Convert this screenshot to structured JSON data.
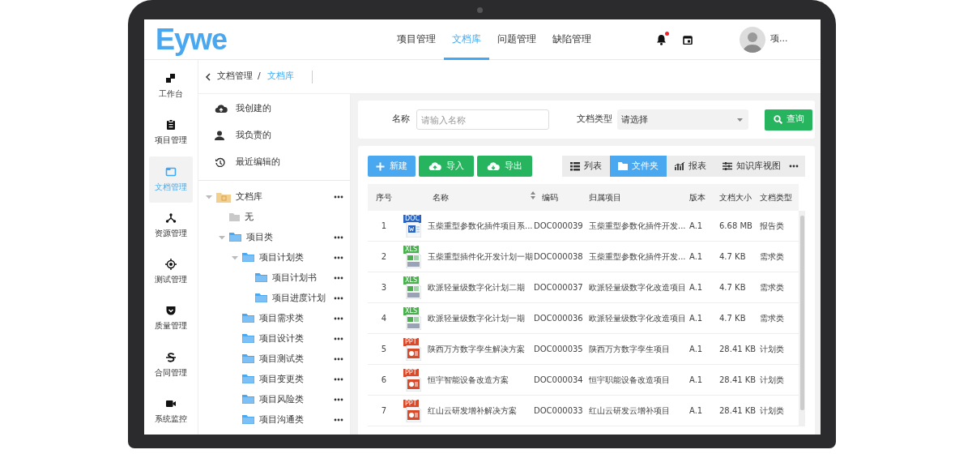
{
  "logo": "Eywe",
  "nav": [
    {
      "label": "项目管理",
      "selected": false
    },
    {
      "label": "文档库",
      "selected": true
    },
    {
      "label": "问题管理",
      "selected": false
    },
    {
      "label": "缺陷管理",
      "selected": false
    }
  ],
  "header": {
    "has_notification": true,
    "user": "项..."
  },
  "rail": [
    {
      "label": "工作台",
      "selected": false
    },
    {
      "label": "项目管理",
      "selected": false
    },
    {
      "label": "文档管理",
      "selected": true
    },
    {
      "label": "资源管理",
      "selected": false
    },
    {
      "label": "测试管理",
      "selected": false
    },
    {
      "label": "质量管理",
      "selected": false
    },
    {
      "label": "合同管理",
      "selected": false
    },
    {
      "label": "系统监控",
      "selected": false
    }
  ],
  "breadcrumb": [
    "文档管理",
    "文档库"
  ],
  "breadcrumb_separator": "/",
  "quick_links": [
    "我创建的",
    "我负责的",
    "最近编辑的"
  ],
  "tree": [
    {
      "label": "文档库",
      "kind": "root",
      "expanded": true,
      "children": [
        {
          "label": "无",
          "kind": "empty"
        },
        {
          "label": "项目类",
          "kind": "folder",
          "expanded": true,
          "children": [
            {
              "label": "项目计划类",
              "kind": "folder",
              "expanded": true,
              "children": [
                {
                  "label": "项目计划书",
                  "kind": "folder"
                },
                {
                  "label": "项目进度计划",
                  "kind": "folder"
                }
              ]
            },
            {
              "label": "项目需求类",
              "kind": "folder"
            },
            {
              "label": "项目设计类",
              "kind": "folder"
            },
            {
              "label": "项目测试类",
              "kind": "folder"
            },
            {
              "label": "项目变更类",
              "kind": "folder"
            },
            {
              "label": "项目风险类",
              "kind": "folder"
            },
            {
              "label": "项目沟通类",
              "kind": "folder"
            }
          ]
        }
      ]
    }
  ],
  "filters": {
    "name_label": "名称",
    "name_placeholder": "请输入名称",
    "type_label": "文档类型",
    "type_value": "请选择",
    "search_button": "查询"
  },
  "actions": [
    {
      "label": "新建",
      "kind": "new"
    },
    {
      "label": "导入",
      "kind": "import"
    },
    {
      "label": "导出",
      "kind": "export"
    }
  ],
  "views": [
    {
      "label": "列表",
      "selected": false
    },
    {
      "label": "文件夹",
      "selected": true
    },
    {
      "label": "报表",
      "selected": false
    },
    {
      "label": "知识库视图",
      "selected": false
    }
  ],
  "table": {
    "columns": [
      "序号",
      "名称",
      "编码",
      "归属项目",
      "版本",
      "文档大小",
      "文档类型"
    ],
    "rows": [
      {
        "index": "1",
        "kind": "doc",
        "badge": "DOC",
        "name": "玉柴重型参数化插件项目系...",
        "code": "DOC000039",
        "project": "玉柴重型参数化插件开发...",
        "version": "A.1",
        "size": "6.68 MB",
        "type": "报告类"
      },
      {
        "index": "2",
        "kind": "xls",
        "badge": "XLS",
        "name": "玉柴重型插件化开发计划一期",
        "code": "DOC000038",
        "project": "玉柴重型参数化插件开发...",
        "version": "A.1",
        "size": "4.7 KB",
        "type": "需求类"
      },
      {
        "index": "3",
        "kind": "xls",
        "badge": "XLS",
        "name": "欧派轻量级数字化计划二期",
        "code": "DOC000037",
        "project": "欧派轻量级数字化改造项目",
        "version": "A.1",
        "size": "4.7 KB",
        "type": "需求类"
      },
      {
        "index": "4",
        "kind": "xls",
        "badge": "XLS",
        "name": "欧派轻量级数字化计划一期",
        "code": "DOC000036",
        "project": "欧派轻量级数字化改造项目",
        "version": "A.1",
        "size": "4.7 KB",
        "type": "需求类"
      },
      {
        "index": "5",
        "kind": "ppt",
        "badge": "PPT",
        "name": "陕西万方数字孪生解决方案",
        "code": "DOC000035",
        "project": "陕西万方数字孪生项目",
        "version": "A.1",
        "size": "28.41 KB",
        "type": "计划类"
      },
      {
        "index": "6",
        "kind": "ppt",
        "badge": "PPT",
        "name": "恒宇智能设备改造方案",
        "code": "DOC000034",
        "project": "恒宇职能设备改造项目",
        "version": "A.1",
        "size": "28.41 KB",
        "type": "计划类"
      },
      {
        "index": "7",
        "kind": "ppt",
        "badge": "PPT",
        "name": "红山云研发增补解决方案",
        "code": "DOC000033",
        "project": "红山云研发云增补项目",
        "version": "A.1",
        "size": "28.41 KB",
        "type": "计划类"
      }
    ]
  }
}
